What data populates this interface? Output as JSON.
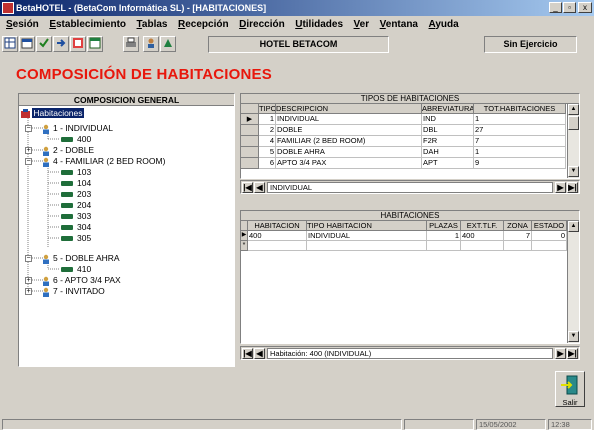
{
  "window": {
    "title": "BetaHOTEL - (BetaCom Informática SL) - [HABITACIONES]",
    "controls": [
      "_",
      "▫",
      "x"
    ]
  },
  "menu": [
    "Sesión",
    "Establecimiento",
    "Tablas",
    "Recepción",
    "Dirección",
    "Utilidades",
    "Ver",
    "Ventana",
    "Ayuda"
  ],
  "toolbar": {
    "hotel_name": "HOTEL BETACOM",
    "ejercicio": "Sin Ejercicio"
  },
  "page_title": "COMPOSICIÓN DE HABITACIONES",
  "tree": {
    "header": "COMPOSICION GENERAL",
    "root": "Habitaciones",
    "nodes": {
      "t1": "1 - INDIVIDUAL",
      "r400": "400",
      "t2": "2 - DOBLE",
      "t4": "4 - FAMILIAR (2 BED ROOM)",
      "r103": "103",
      "r104": "104",
      "r203": "203",
      "r204": "204",
      "r303": "303",
      "r304": "304",
      "r305": "305",
      "t5": "5 - DOBLE AHRA",
      "r410": "410",
      "t6": "6 - APTO 3/4 PAX",
      "t7": "7 - INVITADO"
    }
  },
  "tipos": {
    "title": "TIPOS DE HABITACIONES",
    "columns": [
      "TIPO",
      "DESCRIPCION",
      "ABREVIATURA",
      "TOT.HABITACIONES"
    ],
    "rows": [
      [
        "1",
        "INDIVIDUAL",
        "IND",
        "1"
      ],
      [
        "2",
        "DOBLE",
        "DBL",
        "27"
      ],
      [
        "4",
        "FAMILIAR (2 BED ROOM)",
        "F2R",
        "7"
      ],
      [
        "5",
        "DOBLE AHRA",
        "DAH",
        "1"
      ],
      [
        "6",
        "APTO 3/4 PAX",
        "APT",
        "9"
      ]
    ],
    "nav_text": "INDIVIDUAL"
  },
  "habitaciones": {
    "title": "HABITACIONES",
    "columns": [
      "HABITACION",
      "TIPO HABITACION",
      "PLAZAS",
      "EXT.TLF.",
      "ZONA",
      "ESTADO"
    ],
    "rows": [
      [
        "400",
        "INDIVIDUAL",
        "1",
        "400",
        "7",
        "0"
      ]
    ],
    "nav_text": "Habitación: 400 (INDIVIDUAL)"
  },
  "exit_label": "Salir",
  "status": {
    "date": "15/05/2002",
    "time": "12:38"
  }
}
